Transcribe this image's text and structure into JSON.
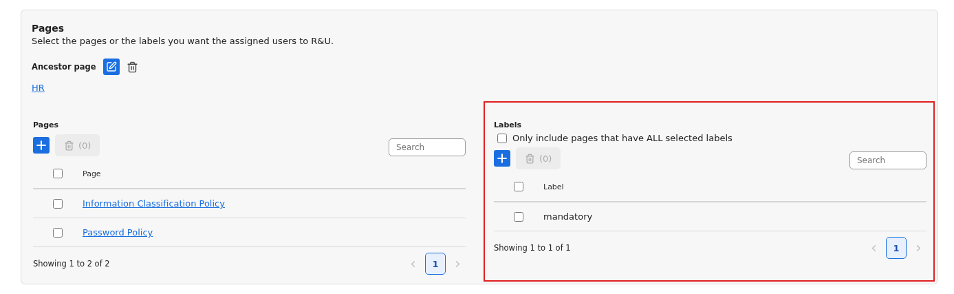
{
  "header": {
    "title": "Pages",
    "description": "Select the pages or the labels you want the assigned users to R&U."
  },
  "ancestor": {
    "label": "Ancestor page",
    "link": "HR"
  },
  "panels": [
    {
      "highlighted": false,
      "title": "Pages",
      "delete_count": "(0)",
      "delete_disabled": true,
      "search": {
        "placeholder": "Search"
      },
      "header_checked": false,
      "column": "Page",
      "rows": [
        {
          "text": "Information Classification Policy",
          "link": true,
          "checked": false
        },
        {
          "text": "Password Policy",
          "link": true,
          "checked": false
        }
      ],
      "footer": "Showing 1 to 2 of 2",
      "pagination": {
        "pages": [
          {
            "label": "1",
            "selected": true
          }
        ],
        "previous_disabled": true,
        "next_disabled": true
      }
    },
    {
      "highlighted": true,
      "title": "Labels",
      "option": {
        "label": "Only include pages that have ALL selected labels",
        "checked": false
      },
      "delete_count": "(0)",
      "delete_disabled": true,
      "search": {
        "placeholder": "Search"
      },
      "header_checked": false,
      "column": "Label",
      "rows": [
        {
          "text": "mandatory",
          "link": false,
          "checked": false
        }
      ],
      "footer": "Showing 1 to 1 of 1",
      "pagination": {
        "pages": [
          {
            "label": "1",
            "selected": true
          }
        ],
        "previous_disabled": true,
        "next_disabled": true
      }
    }
  ]
}
